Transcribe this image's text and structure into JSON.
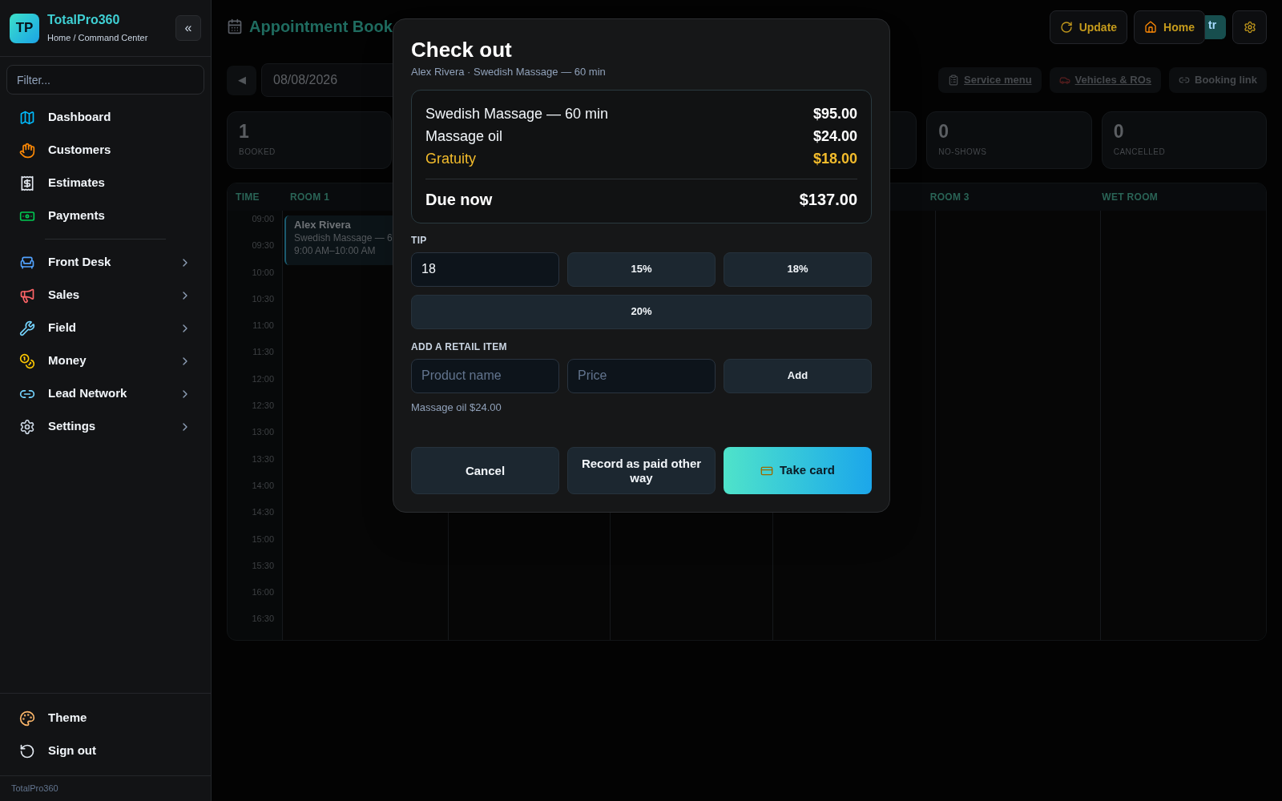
{
  "sidebar": {
    "brand": {
      "logo": "TP",
      "name": "TotalPro360",
      "breadcrumb": "Home / Command Center",
      "collapse": "«"
    },
    "filter": {
      "placeholder": "Filter..."
    },
    "links": [
      {
        "label": "Dashboard"
      },
      {
        "label": "Customers"
      },
      {
        "label": "Estimates"
      },
      {
        "label": "Payments"
      }
    ],
    "groups": [
      {
        "label": "Front Desk",
        "expanded": false
      },
      {
        "label": "Sales",
        "expanded": false
      },
      {
        "label": "Field",
        "expanded": false
      },
      {
        "label": "Money",
        "expanded": false
      },
      {
        "label": "Lead Network",
        "expanded": false
      },
      {
        "label": "Settings",
        "expanded": false
      }
    ],
    "bottom": [
      {
        "label": "Theme"
      },
      {
        "label": "Sign out"
      }
    ],
    "footer": "TotalPro360"
  },
  "header": {
    "title": "Appointment Book",
    "buttons": [
      {
        "kind": "update",
        "label": "Update"
      },
      {
        "kind": "home",
        "label": "Home"
      },
      {
        "kind": "partial",
        "label": "tr"
      },
      {
        "kind": "settings"
      }
    ]
  },
  "toolbar": {
    "prev": "◀",
    "date": "08/08/2026",
    "links": [
      {
        "label": "Service menu",
        "underlined": true
      },
      {
        "label": "Vehicles & ROs",
        "underlined": true
      },
      {
        "label": "Booking link",
        "underlined": false
      }
    ]
  },
  "stats": [
    {
      "value": "1",
      "label": "BOOKED"
    },
    {
      "value": "0",
      "label": "NO-SHOWS"
    },
    {
      "value": "0",
      "label": "CANCELLED"
    }
  ],
  "calendar": {
    "time_header": "TIME",
    "times": [
      "09:00",
      "09:30",
      "10:00",
      "10:30",
      "11:00",
      "11:30",
      "12:00",
      "12:30",
      "13:00",
      "13:30",
      "14:00",
      "14:30",
      "15:00",
      "15:30",
      "16:00",
      "16:30"
    ],
    "columns": [
      {
        "name": "ROOM 1",
        "events": [
          {
            "name": "Alex Rivera",
            "service": "Swedish Massage — 6",
            "time": "9:00 AM–10:00 AM"
          }
        ]
      },
      {
        "name": "ROOM 3"
      },
      {
        "name": "WET ROOM"
      }
    ]
  },
  "checkout": {
    "title": "Check out",
    "subtitle": "Alex Rivera · Swedish Massage — 60 min",
    "lines": [
      {
        "kind": "item",
        "label": "Swedish Massage — 60 min",
        "amount": "$95.00"
      },
      {
        "kind": "item",
        "label": "Massage oil",
        "amount": "$24.00"
      },
      {
        "kind": "tip",
        "label": "Gratuity",
        "amount": "$18.00"
      }
    ],
    "total": {
      "label": "Due now",
      "amount": "$137.00"
    },
    "tip": {
      "label": "TIP",
      "value": "18",
      "presets": [
        "15%",
        "18%",
        "20%"
      ]
    },
    "retail": {
      "label": "ADD A RETAIL ITEM",
      "name_placeholder": "Product name",
      "price_placeholder": "Price",
      "add": "Add",
      "added": [
        "Massage oil $24.00"
      ]
    },
    "actions": [
      {
        "kind": "secondary",
        "label": "Cancel"
      },
      {
        "kind": "secondary",
        "label": "Record as paid other way"
      },
      {
        "kind": "primary",
        "label": "Take card"
      }
    ]
  }
}
